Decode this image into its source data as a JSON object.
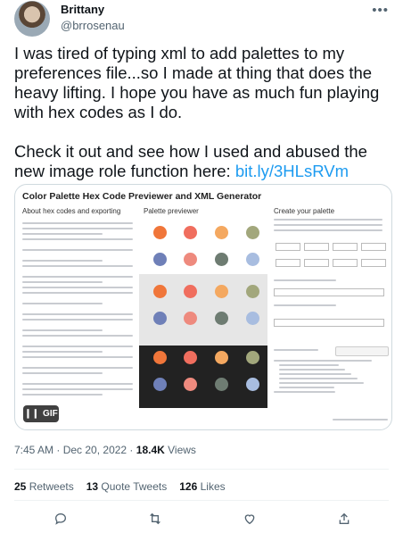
{
  "user": {
    "name": "Brittany",
    "handle": "@brrosenau"
  },
  "tweet": {
    "paragraph1": "I was tired of typing xml to add palettes to my preferences file...so I made at thing that does the heavy lifting. I hope you have as much fun playing with hex codes as I do.",
    "paragraph2_text": "Check it out and see how I used and abused the new image role function here: ",
    "paragraph2_link": "bit.ly/3HLsRVm"
  },
  "media": {
    "title": "Color Palette Hex Code Previewer and XML Generator",
    "col1_heading": "About hex codes and exporting",
    "col2_heading": "Palette previewer",
    "col3_heading": "Create your palette",
    "gif_label": "GIF",
    "palette_colors": [
      "#f0763a",
      "#f06e5e",
      "#f4a860",
      "#a2a77c",
      "#6f80b8",
      "#ee8a7e",
      "#6e7c72",
      "#a8bde0"
    ],
    "band_colors": [
      "#ffffff",
      "#e6e6e6",
      "#222222"
    ]
  },
  "meta": {
    "time": "7:45 AM",
    "separator": " · ",
    "date": "Dec 20, 2022",
    "views_count": "18.4K",
    "views_label": " Views"
  },
  "stats": {
    "retweets_count": "25",
    "retweets_label": " Retweets",
    "quotes_count": "13",
    "quotes_label": " Quote Tweets",
    "likes_count": "126",
    "likes_label": " Likes"
  },
  "actions": {
    "reply_icon": "reply-icon",
    "retweet_icon": "retweet-icon",
    "like_icon": "heart-icon",
    "share_icon": "share-icon"
  },
  "colors": {
    "link": "#1d9bf0",
    "secondary": "#536471"
  }
}
